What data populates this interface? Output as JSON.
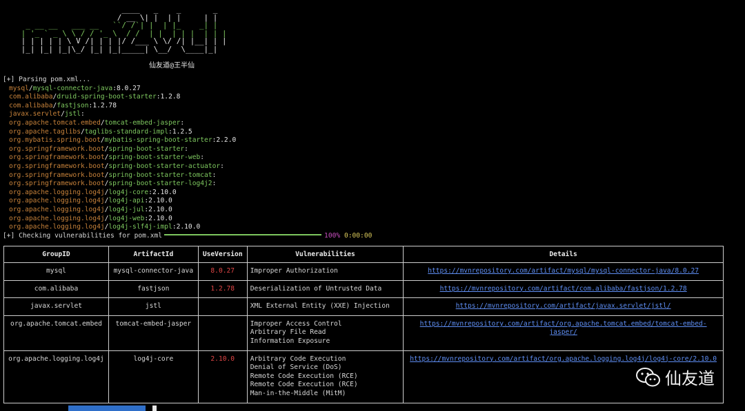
{
  "banner": {
    "ascii_art": [
      "                       ____   _    _       _  ",
      "                      / __ \\| |  | |     | | ",
      "  _ __ __   ___ __   ``/ /`| |  | |_    _| | ",
      " | '_ ` _ \\ \\ / / '_ \\  / /  | |  | | |  | | | ",
      " | | | | | \\ V /| | | |/ /___ \\ \\/ /| |__| | | ",
      " |_| |_| |_|\\_/ |_| |_|_____| \\__/  \\____|_| "
    ],
    "author": "仙友道@王半仙"
  },
  "terminal": {
    "parsing": "[+] Parsing pom.xml...",
    "dependencies": [
      {
        "group": "mysql",
        "artifact": "mysql-connector-java",
        "version": "8.0.27"
      },
      {
        "group": "com.alibaba",
        "artifact": "druid-spring-boot-starter",
        "version": "1.2.8"
      },
      {
        "group": "com.alibaba",
        "artifact": "fastjson",
        "version": "1.2.78"
      },
      {
        "group": "javax.servlet",
        "artifact": "jstl",
        "version": ""
      },
      {
        "group": "org.apache.tomcat.embed",
        "artifact": "tomcat-embed-jasper",
        "version": ""
      },
      {
        "group": "org.apache.taglibs",
        "artifact": "taglibs-standard-impl",
        "version": "1.2.5"
      },
      {
        "group": "org.mybatis.spring.boot",
        "artifact": "mybatis-spring-boot-starter",
        "version": "2.2.0"
      },
      {
        "group": "org.springframework.boot",
        "artifact": "spring-boot-starter",
        "version": ""
      },
      {
        "group": "org.springframework.boot",
        "artifact": "spring-boot-starter-web",
        "version": ""
      },
      {
        "group": "org.springframework.boot",
        "artifact": "spring-boot-starter-actuator",
        "version": ""
      },
      {
        "group": "org.springframework.boot",
        "artifact": "spring-boot-starter-tomcat",
        "version": ""
      },
      {
        "group": "org.springframework.boot",
        "artifact": "spring-boot-starter-log4j2",
        "version": ""
      },
      {
        "group": "org.apache.logging.log4j",
        "artifact": "log4j-core",
        "version": "2.10.0"
      },
      {
        "group": "org.apache.logging.log4j",
        "artifact": "log4j-api",
        "version": "2.10.0"
      },
      {
        "group": "org.apache.logging.log4j",
        "artifact": "log4j-jul",
        "version": "2.10.0"
      },
      {
        "group": "org.apache.logging.log4j",
        "artifact": "log4j-web",
        "version": "2.10.0"
      },
      {
        "group": "org.apache.logging.log4j",
        "artifact": "log4j-slf4j-impl",
        "version": "2.10.0"
      }
    ],
    "checking": "[+] Checking vulnerabilities for pom.xml",
    "progress_percent": "100%",
    "progress_value": 1.0,
    "elapsed": "0:00:00"
  },
  "table": {
    "headers": [
      "GroupID",
      "ArtifactId",
      "UseVersion",
      "Vulnerabilities",
      "Details"
    ],
    "rows": [
      {
        "group": "mysql",
        "artifact": "mysql-connector-java",
        "version": "8.0.27",
        "vulns": [
          "Improper Authorization"
        ],
        "details": "https://mvnrepository.com/artifact/mysql/mysql-connector-java/8.0.27"
      },
      {
        "group": "com.alibaba",
        "artifact": "fastjson",
        "version": "1.2.78",
        "vulns": [
          "Deserialization of Untrusted Data"
        ],
        "details": "https://mvnrepository.com/artifact/com.alibaba/fastjson/1.2.78"
      },
      {
        "group": "javax.servlet",
        "artifact": "jstl",
        "version": "",
        "vulns": [
          "XML External Entity (XXE) Injection"
        ],
        "details": "https://mvnrepository.com/artifact/javax.servlet/jstl/"
      },
      {
        "group": "org.apache.tomcat.embed",
        "artifact": "tomcat-embed-jasper",
        "version": "",
        "vulns": [
          "Improper Access Control",
          "Arbitrary File Read",
          "Information Exposure"
        ],
        "details": "https://mvnrepository.com/artifact/org.apache.tomcat.embed/tomcat-embed-jasper/"
      },
      {
        "group": "org.apache.logging.log4j",
        "artifact": "log4j-core",
        "version": "2.10.0",
        "vulns": [
          "Arbitrary Code Execution",
          "Denial of Service (DoS)",
          "Remote Code Execution (RCE)",
          "Remote Code Execution (RCE)",
          "Man-in-the-Middle (MitM)"
        ],
        "details": "https://mvnrepository.com/artifact/org.apache.logging.log4j/log4j-core/2.10.0"
      }
    ]
  },
  "watermark": {
    "text": "仙友道",
    "icon": "wechat-icon"
  },
  "colors": {
    "group": "#c7823a",
    "artifact": "#7ec85f",
    "version_vuln": "#e24646",
    "link": "#5f8ff5",
    "progress": "#7ec85f",
    "percent": "#c84fbf",
    "elapsed": "#d9c85a"
  }
}
